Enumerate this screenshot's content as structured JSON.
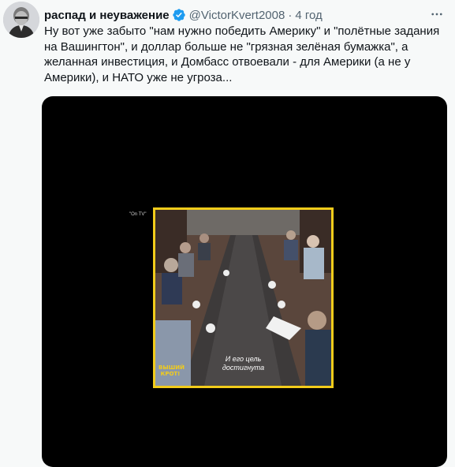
{
  "tweet": {
    "author_name": "распад и неуважение",
    "handle": "@VictorKvert2008",
    "separator": "·",
    "time": "4 год",
    "text": "Ну вот уже забыто \"нам нужно победить Америку\" и \"полётные задания на Вашингтон\", и доллар больше не \"грязная зелёная бумажка\", а желанная инвестиция, и Домбасс отвоевали - для Америки (а не у Америки), и НАТО уже не угроза..."
  },
  "video": {
    "watermark_top": "\"On TV\"",
    "subtitle_line1": "И его цель",
    "subtitle_line2": "достигнута",
    "logo_line1": "ВЫШИЙ",
    "logo_line2": "КРОТ!"
  },
  "colors": {
    "background": "#f7f9f9",
    "text": "#0f1419",
    "secondary": "#536471",
    "verified": "#1d9bf0",
    "frame_border": "#f2cc1b",
    "media_bg": "#000000"
  },
  "icons": [
    "avatar",
    "verified-badge-icon",
    "more-options-icon"
  ]
}
